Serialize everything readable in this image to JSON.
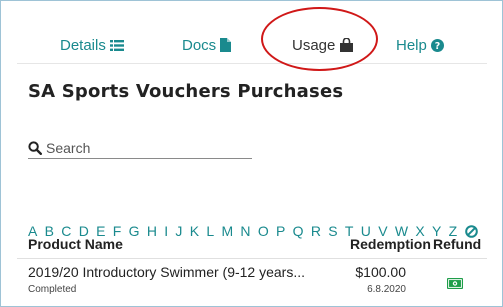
{
  "tabs": [
    {
      "label": "Details",
      "icon": "list-icon"
    },
    {
      "label": "Docs",
      "icon": "document-icon"
    },
    {
      "label": "Usage",
      "icon": "shopping-bag-icon"
    },
    {
      "label": "Help",
      "icon": "question-circle-icon"
    }
  ],
  "active_tab": "Usage",
  "title": "SA Sports Vouchers Purchases",
  "search": {
    "placeholder": "Search",
    "value": ""
  },
  "alphabet": [
    "A",
    "B",
    "C",
    "D",
    "E",
    "F",
    "G",
    "H",
    "I",
    "J",
    "K",
    "L",
    "M",
    "N",
    "O",
    "P",
    "Q",
    "R",
    "S",
    "T",
    "U",
    "V",
    "W",
    "X",
    "Y",
    "Z"
  ],
  "table": {
    "headers": {
      "product": "Product Name",
      "redemption": "Redemption",
      "refund": "Refund"
    },
    "rows": [
      {
        "product": "2019/20 Introductory Swimmer (9-12 years...",
        "status": "Completed",
        "amount": "$100.00",
        "date": "6.8.2020",
        "refund_icon": "cash-icon"
      }
    ]
  },
  "colors": {
    "accent": "#1a8a8e",
    "highlight": "#d01818",
    "refund_green": "#1f9e4a"
  }
}
